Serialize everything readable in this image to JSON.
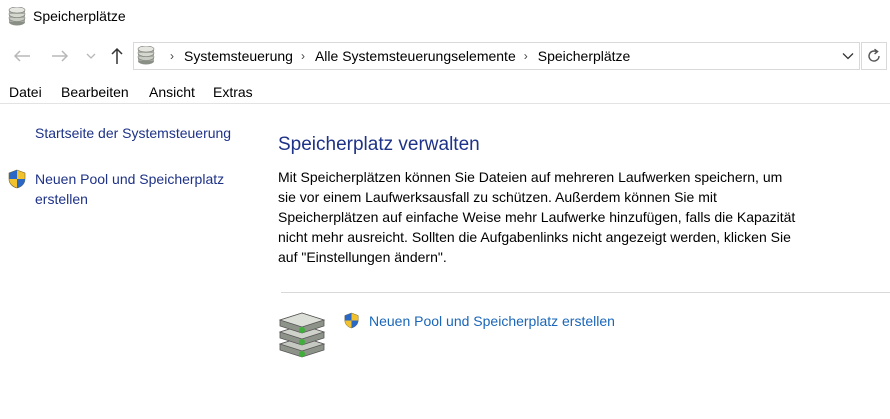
{
  "window": {
    "title": "Speicherplätze",
    "icon": "storage-spaces-icon"
  },
  "nav": {
    "back_icon": "arrow-left-icon",
    "forward_icon": "arrow-right-icon",
    "recent_icon": "chevron-down-icon",
    "up_icon": "arrow-up-icon",
    "breadcrumbs": [
      "Systemsteuerung",
      "Alle Systemsteuerungselemente",
      "Speicherplätze"
    ],
    "separator": "›",
    "refresh_icon": "refresh-icon"
  },
  "menu": [
    "Datei",
    "Bearbeiten",
    "Ansicht",
    "Extras"
  ],
  "sidebar": {
    "home_link": "Startseite der Systemsteuerung",
    "new_pool_line1": "Neuen Pool und Speicherplatz",
    "new_pool_line2": "erstellen"
  },
  "main": {
    "heading": "Speicherplatz verwalten",
    "description": "Mit Speicherplätzen können Sie Dateien auf mehreren Laufwerken speichern, um sie vor einem Laufwerksausfall zu schützen. Außerdem können Sie mit Speicherplätzen auf einfache Weise mehr Laufwerke hinzufügen, falls die Kapazität nicht mehr ausreicht. Sollten die Aufgabenlinks nicht angezeigt werden, klicken Sie auf \"Einstellungen ändern\".",
    "task_link": "Neuen Pool und Speicherplatz erstellen"
  },
  "colors": {
    "link_dark": "#1e3287",
    "link_blue": "#1a66b8",
    "border": "#d9d9d9"
  }
}
